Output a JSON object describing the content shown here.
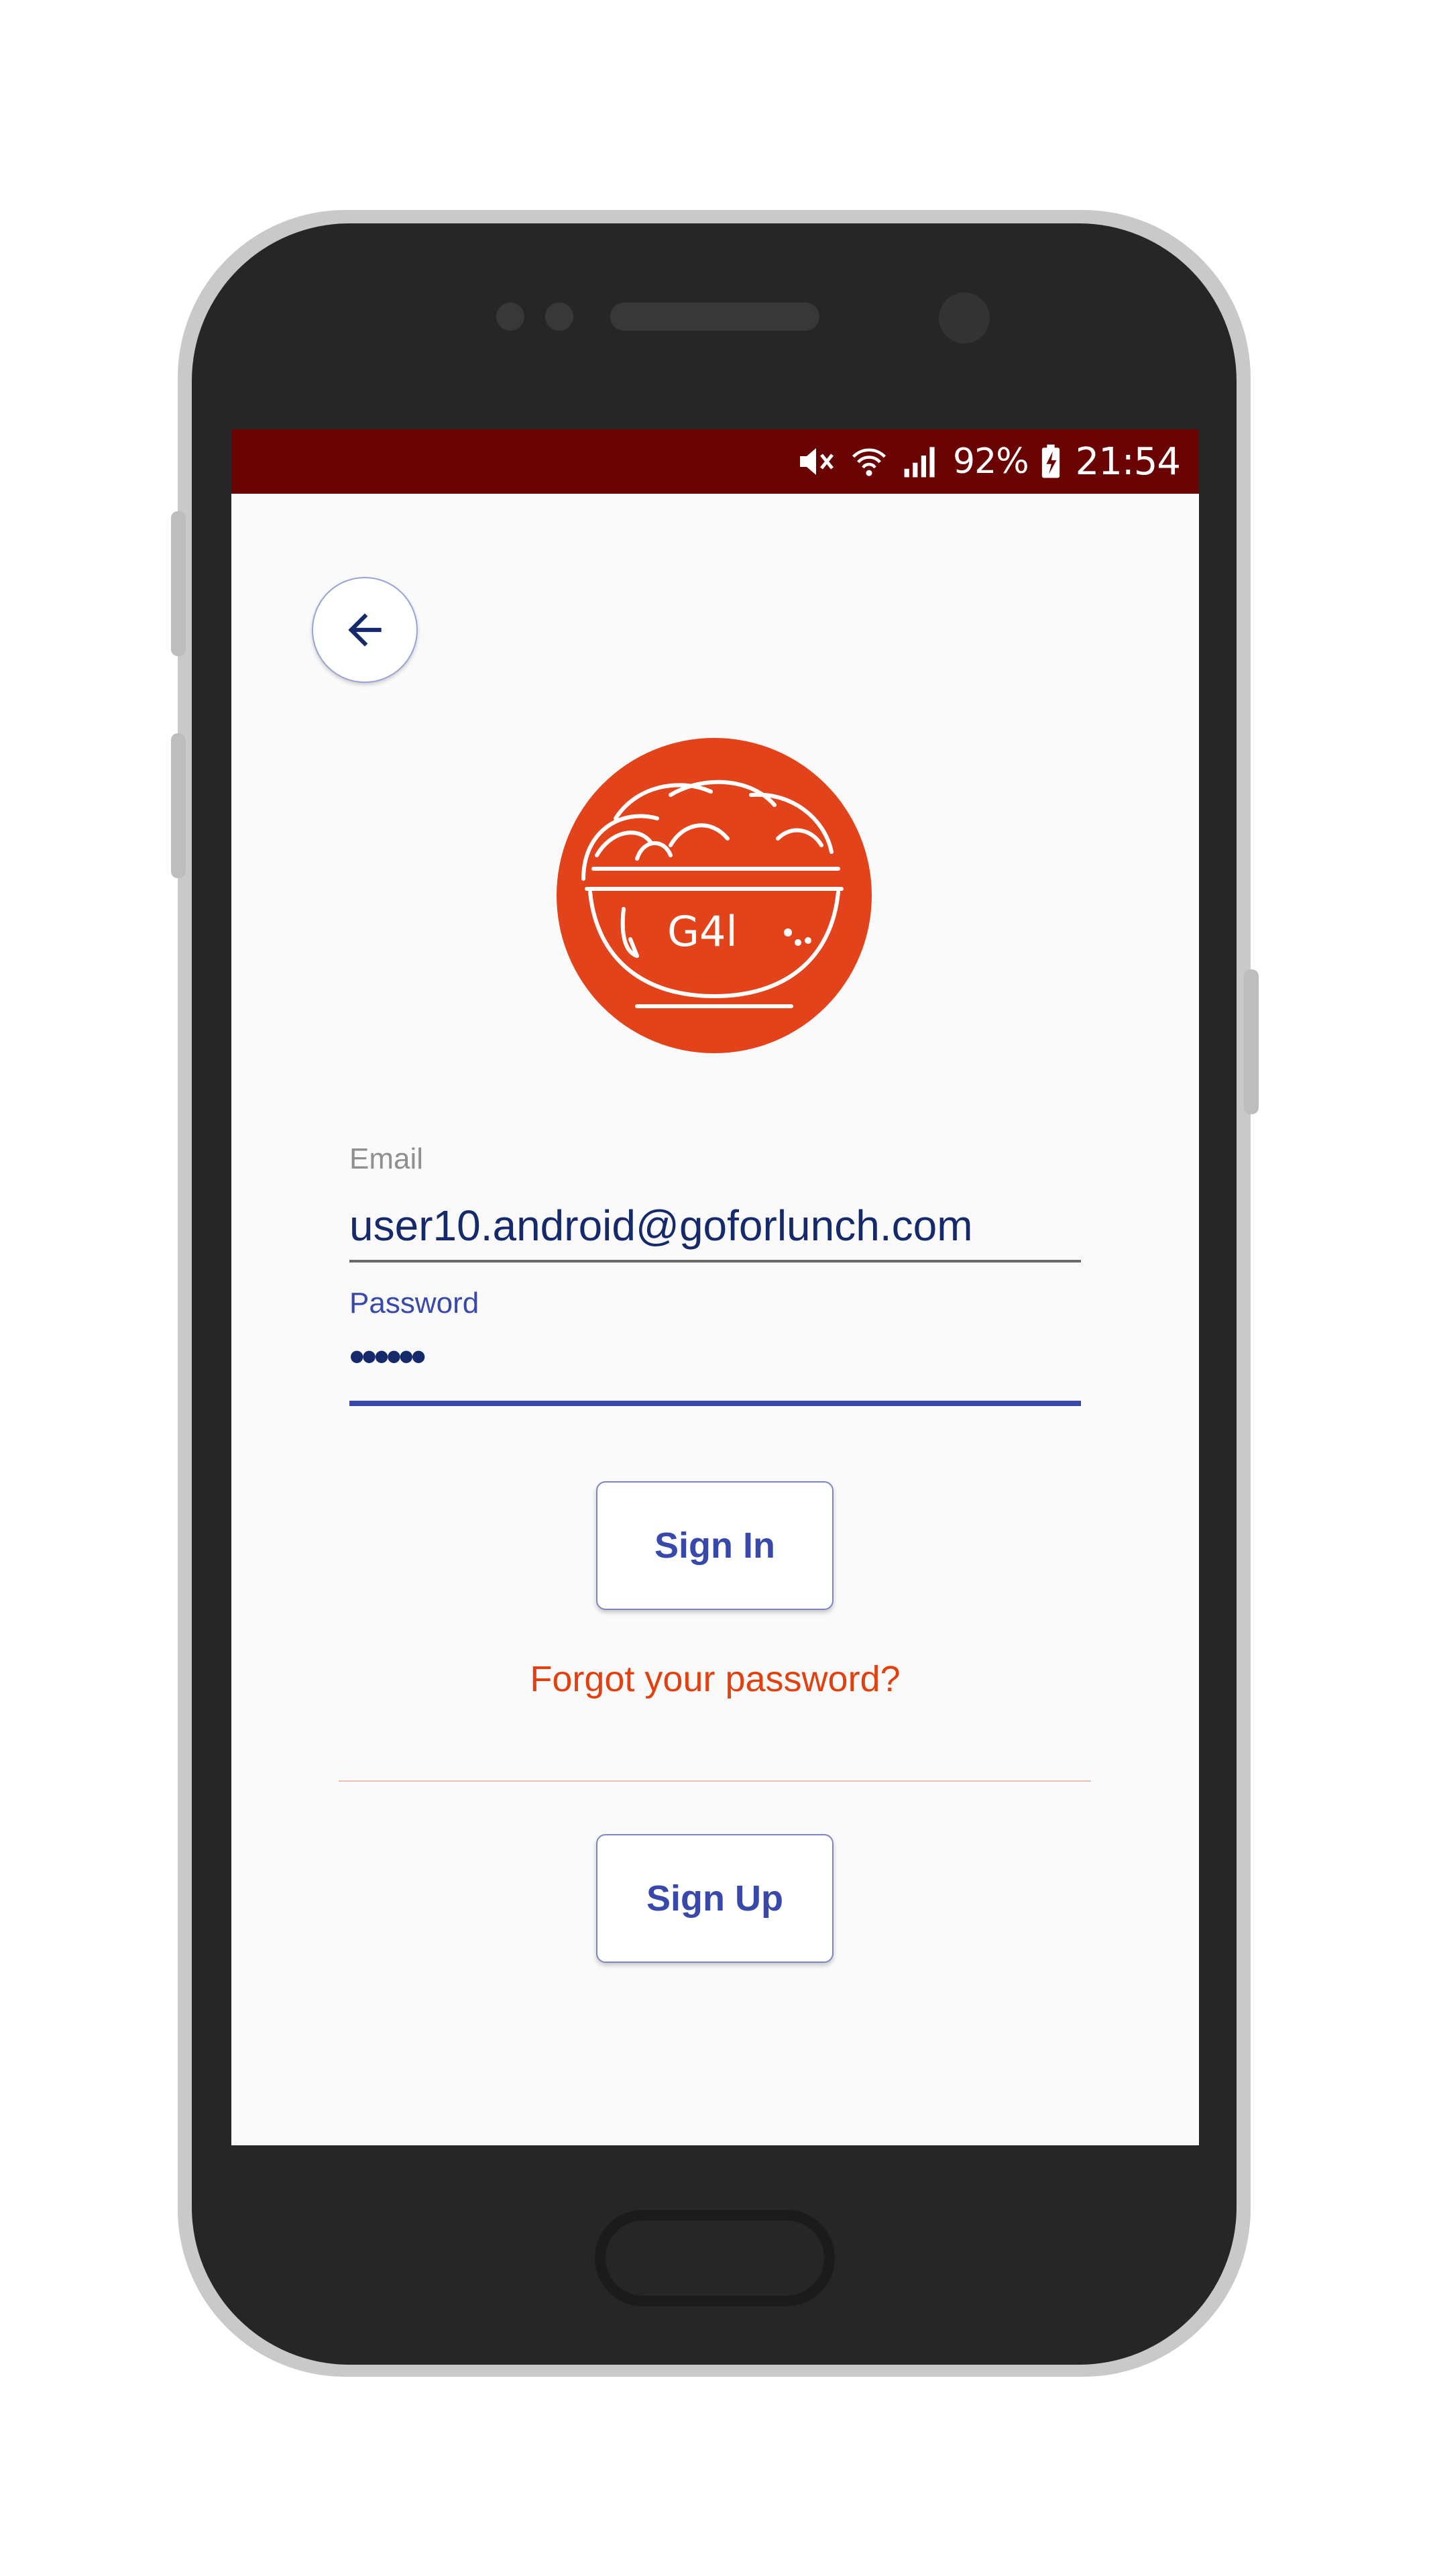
{
  "status_bar": {
    "battery_percent": "92%",
    "time": "21:54",
    "icons": [
      "mute-icon",
      "wifi-icon",
      "signal-icon",
      "battery-charging-icon"
    ],
    "background_color": "#690403"
  },
  "logo": {
    "text": "G4l",
    "color": "#e3431b"
  },
  "form": {
    "email": {
      "label": "Email",
      "value": "user10.android@goforlunch.com"
    },
    "password": {
      "label": "Password",
      "value": "••••••"
    }
  },
  "actions": {
    "sign_in_label": "Sign In",
    "forgot_password_label": "Forgot your password?",
    "sign_up_label": "Sign Up"
  },
  "colors": {
    "accent": "#3949ab",
    "link": "#e3400f",
    "text_value": "#16296b"
  }
}
